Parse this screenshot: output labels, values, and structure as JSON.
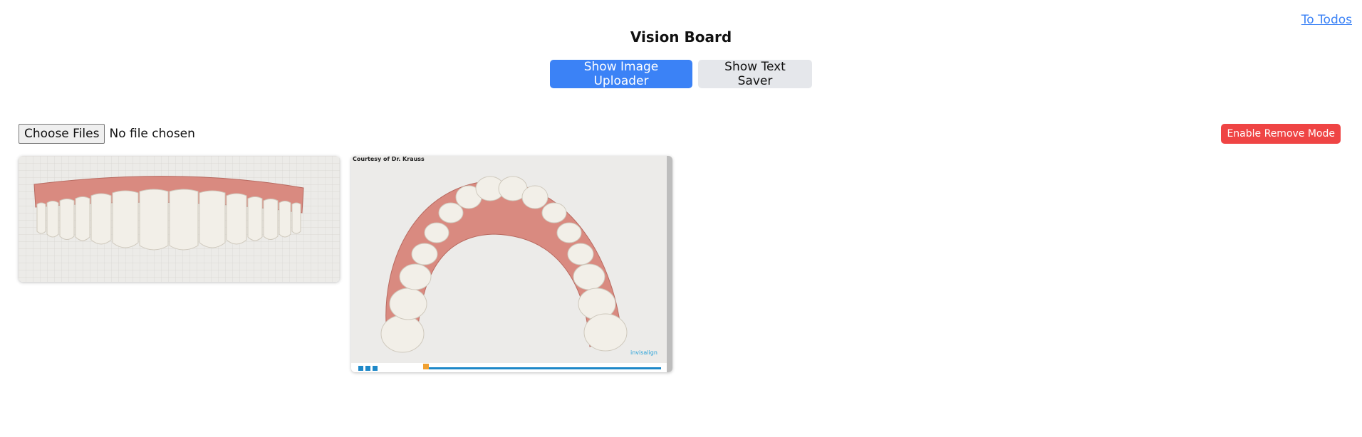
{
  "header": {
    "todos_link": "To Todos",
    "title": "Vision Board"
  },
  "toggles": {
    "image_uploader": "Show Image Uploader",
    "text_saver": "Show Text Saver"
  },
  "file_input": {
    "button_label": "Choose Files",
    "status": "No file chosen"
  },
  "remove_mode": {
    "label": "Enable Remove Mode"
  },
  "gallery": [
    {
      "caption": ""
    },
    {
      "caption": "Courtesy of Dr. Krauss",
      "brand": "invisalign"
    }
  ],
  "colors": {
    "accent": "#3b82f6",
    "danger": "#ef4444",
    "secondary": "#e5e7eb",
    "gum": "#d98a80",
    "tooth": "#f2efe8"
  }
}
